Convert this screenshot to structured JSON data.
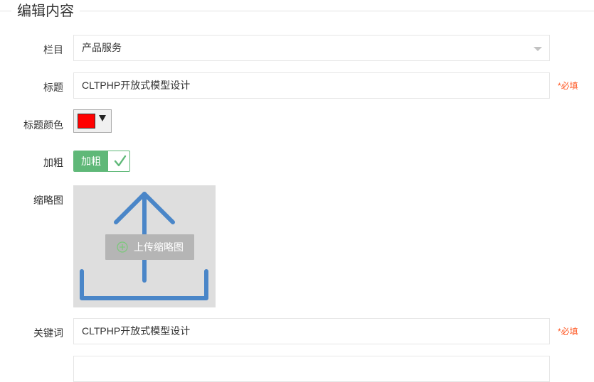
{
  "legend": "编辑内容",
  "fields": {
    "column": {
      "label": "栏目",
      "value": "产品服务"
    },
    "title": {
      "label": "标题",
      "value": "CLTPHP开放式模型设计",
      "required": "*必填"
    },
    "title_color": {
      "label": "标题颜色",
      "color": "#ff0000"
    },
    "bold": {
      "label": "加粗",
      "switch_text": "加粗",
      "checked": true
    },
    "thumbnail": {
      "label": "缩略图",
      "upload_label": "上传缩略图"
    },
    "keywords": {
      "label": "关键词",
      "value": "CLTPHP开放式模型设计",
      "required": "*必填"
    }
  },
  "colors": {
    "accent_green": "#5fb878",
    "required_red": "#ff5722",
    "upload_icon_blue": "#4a86c8"
  }
}
